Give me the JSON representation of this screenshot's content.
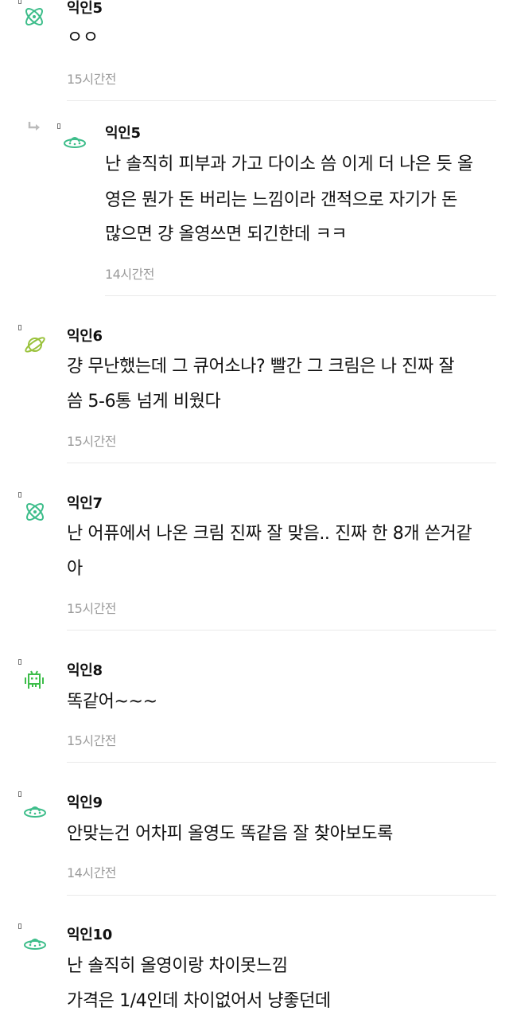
{
  "comments": [
    {
      "author": "익인5",
      "lines": [
        "ㅇㅇ"
      ],
      "time": "15시간전",
      "avatar": "atom-icon",
      "avatar_color": "#3dbd8a"
    },
    {
      "author": "익인5",
      "lines": [
        "난 솔직히 피부과 가고 다이소 씀 이게 더 나은 듯 올",
        "영은 뭔가 돈 버리는 느낌이라 갠적으로 자기가 돈",
        "많으면 걍 올영쓰면 되긴한데 ㅋㅋ"
      ],
      "time": "14시간전",
      "avatar": "ufo-icon",
      "avatar_color": "#3dbd8a",
      "is_reply": true
    },
    {
      "author": "익인6",
      "lines": [
        "걍 무난했는데 그 큐어소나? 빨간 그 크림은 나 진짜 잘",
        "씀 5-6통 넘게 비웠다"
      ],
      "time": "15시간전",
      "avatar": "planet-icon",
      "avatar_color": "#9ac23c"
    },
    {
      "author": "익인7",
      "lines": [
        "난 어퓨에서 나온 크림 진짜 잘 맞음.. 진짜 한 8개 쓴거같",
        "아"
      ],
      "time": "15시간전",
      "avatar": "atom-icon",
      "avatar_color": "#3dbd8a"
    },
    {
      "author": "익인8",
      "lines": [
        "똑같어~~~"
      ],
      "time": "15시간전",
      "avatar": "invader-icon",
      "avatar_color": "#3dbd4a"
    },
    {
      "author": "익인9",
      "lines": [
        "안맞는건 어차피 올영도 똑같음 잘 찾아보도록"
      ],
      "time": "14시간전",
      "avatar": "ufo-icon",
      "avatar_color": "#3dbd8a"
    },
    {
      "author": "익인10",
      "lines": [
        "난 솔직히 올영이랑 차이못느낌",
        "가격은 1/4인데 차이없어서 냥좋던데"
      ],
      "time": "",
      "avatar": "ufo-icon",
      "avatar_color": "#3dbd8a"
    }
  ]
}
